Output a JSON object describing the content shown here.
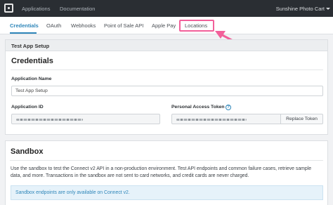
{
  "topbar": {
    "nav": [
      "Applications",
      "Documentation"
    ],
    "account": "Sunshine Photo Cart"
  },
  "tabs": [
    {
      "label": "Credentials",
      "active": true
    },
    {
      "label": "OAuth",
      "active": false
    },
    {
      "label": "Webhooks",
      "active": false
    },
    {
      "label": "Point of Sale API",
      "active": false
    },
    {
      "label": "Apple Pay",
      "active": false
    },
    {
      "label": "Locations",
      "active": false,
      "highlighted": true
    }
  ],
  "annotation": {
    "color": "#f2609a"
  },
  "app_card": {
    "header": "Test App Setup",
    "section_title": "Credentials",
    "application_name": {
      "label": "Application Name",
      "value": "Test App Setup"
    },
    "application_id": {
      "label": "Application ID",
      "value_obscured": true
    },
    "personal_access_token": {
      "label": "Personal Access Token",
      "value_obscured": true,
      "button": "Replace Token"
    }
  },
  "sandbox": {
    "title": "Sandbox",
    "description": "Use the sandbox to test the Connect v2 API in a non-production environment. Test API endpoints and common failure cases, retrieve sample data, and more. Transactions in the sandbox are not sent to card networks, and credit cards are never charged.",
    "notice": "Sandbox endpoints are only available on Connect v2."
  },
  "colors": {
    "accent": "#2e86b9",
    "topbar": "#2a2e33"
  }
}
